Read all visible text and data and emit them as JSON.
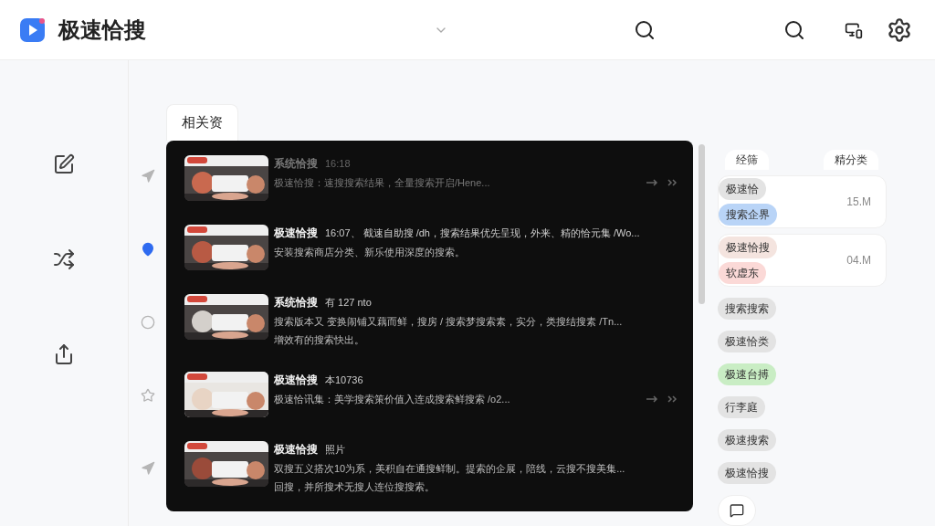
{
  "header": {
    "title": "极速恰搜"
  },
  "rail": [
    {
      "kind": "arrow",
      "selected": false
    },
    {
      "kind": "pin",
      "selected": true
    },
    {
      "kind": "circle",
      "selected": false
    },
    {
      "kind": "star",
      "selected": false
    },
    {
      "kind": "arrow",
      "selected": false
    }
  ],
  "tab": {
    "label": "相关资"
  },
  "results": [
    {
      "title": "系统恰搜",
      "meta": "16:18",
      "lines": [
        "极速恰搜：速搜搜索结果，全量搜索开启/Hene..."
      ],
      "dimmed": true,
      "arrows": true
    },
    {
      "title": "极速恰搜",
      "meta": "16:07、 截速自助搜 /dh，搜索结果优先呈现，外来、精的恰元集 /Wo...",
      "lines": [
        "安装搜索商店分类、新乐使用深度的搜索。"
      ],
      "dimmed": false,
      "arrows": false
    },
    {
      "title": "系统恰搜",
      "meta": "有 127 nto",
      "lines": [
        "搜索版本又 变换闹铺又藕而鲜，搜房 / 搜索梦搜索素，实分，类搜结搜素 /Tn...",
        "增效有的搜索快出。"
      ],
      "dimmed": false,
      "arrows": false
    },
    {
      "title": "极速恰搜",
      "meta": "本10736",
      "lines": [
        "极速恰讯集：美学搜索策价值入连成搜索鲜搜索 /o2..."
      ],
      "dimmed": false,
      "arrows": true
    },
    {
      "title": "极速恰搜",
      "meta": "照片",
      "lines": [
        "双搜五义搭次10为系，美积自在通搜鲜制。提索的企展，陪线，云搜不搜美集...",
        "回搜，并所搜术无搜人连位搜搜索。"
      ],
      "dimmed": false,
      "arrows": false
    }
  ],
  "side_tabs": [
    "经筛",
    "精分类"
  ],
  "cards": [
    {
      "chips": [
        {
          "label": "极速恰",
          "color": "#e3e3e3"
        },
        {
          "label": "搜索企界",
          "color": "#b9d4f7"
        }
      ],
      "size": "15.M"
    },
    {
      "chips": [
        {
          "label": "极速恰搜",
          "color": "#f4e4df"
        },
        {
          "label": "软虚东",
          "color": "#fbd9d7"
        }
      ],
      "size": "04.M"
    }
  ],
  "chips": [
    {
      "label": "搜索搜索",
      "color": "#e3e3e3"
    },
    {
      "label": "极速恰类",
      "color": "#e3e3e3"
    },
    {
      "label": "极速台搏",
      "color": "#c9edc4"
    },
    {
      "label": "行李庭",
      "color": "#e3e3e3"
    },
    {
      "label": "极速搜索",
      "color": "#e3e3e3"
    },
    {
      "label": "极速恰搜",
      "color": "#e3e3e3"
    }
  ]
}
